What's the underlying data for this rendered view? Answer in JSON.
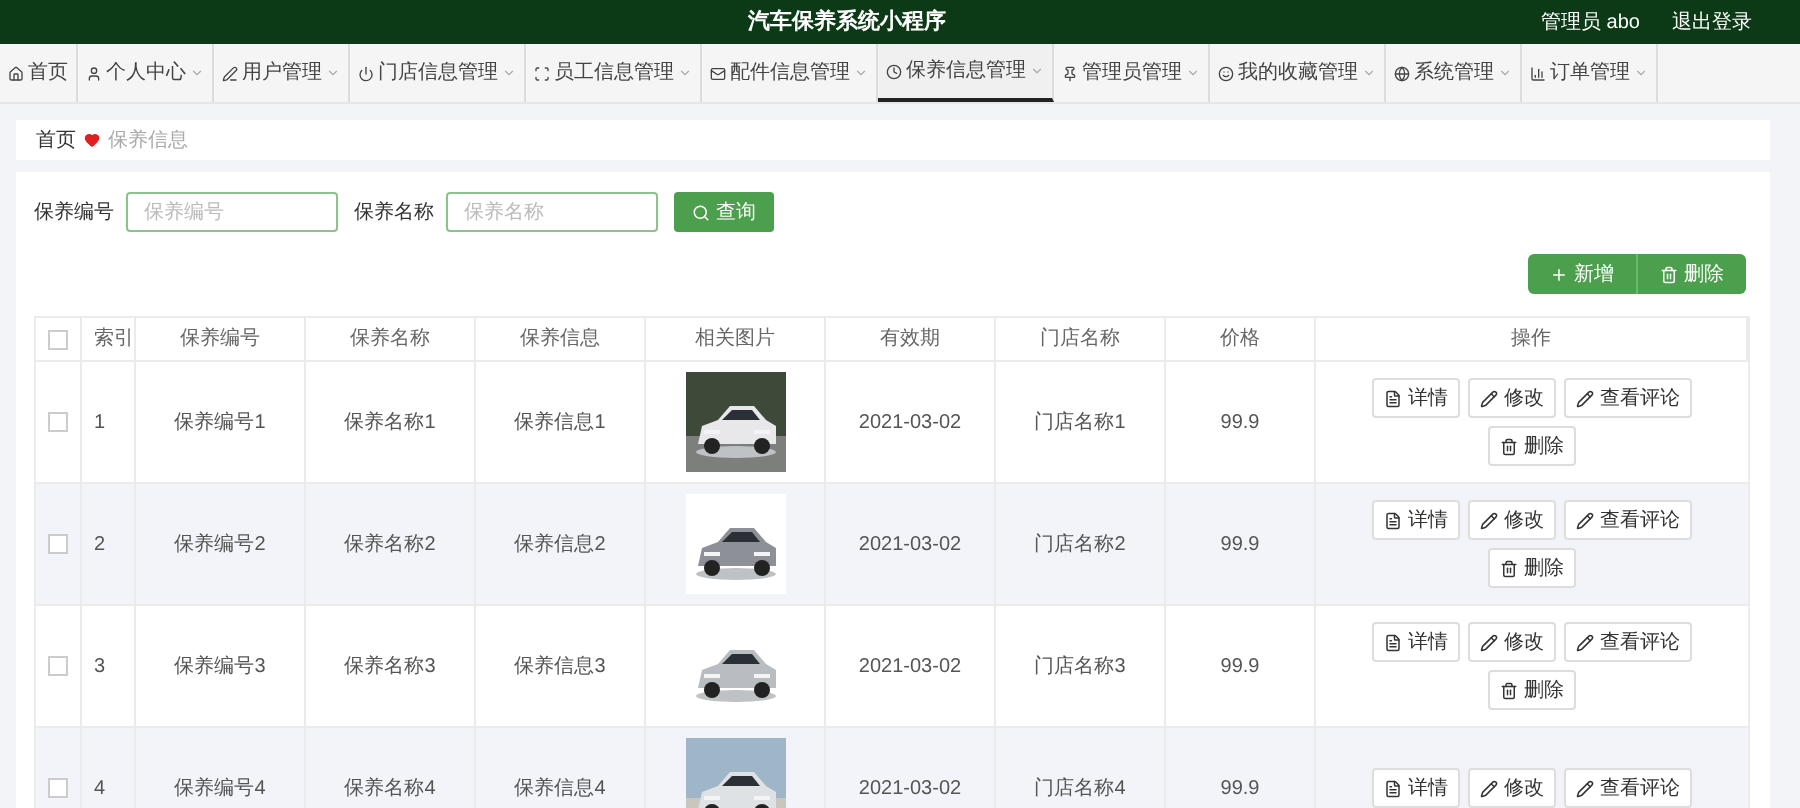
{
  "header": {
    "title": "汽车保养系统小程序",
    "user": "管理员 abo",
    "logout": "退出登录"
  },
  "nav": [
    {
      "label": "首页",
      "selected": false,
      "dropdown": false
    },
    {
      "label": "个人中心",
      "selected": false,
      "dropdown": true
    },
    {
      "label": "用户管理",
      "selected": false,
      "dropdown": true
    },
    {
      "label": "门店信息管理",
      "selected": false,
      "dropdown": true
    },
    {
      "label": "员工信息管理",
      "selected": false,
      "dropdown": true
    },
    {
      "label": "配件信息管理",
      "selected": false,
      "dropdown": true
    },
    {
      "label": "保养信息管理",
      "selected": true,
      "dropdown": true
    },
    {
      "label": "管理员管理",
      "selected": false,
      "dropdown": true
    },
    {
      "label": "我的收藏管理",
      "selected": false,
      "dropdown": true
    },
    {
      "label": "系统管理",
      "selected": false,
      "dropdown": true
    },
    {
      "label": "订单管理",
      "selected": false,
      "dropdown": true
    }
  ],
  "breadcrumb": {
    "home": "首页",
    "current": "保养信息"
  },
  "search": {
    "fields": [
      {
        "label": "保养编号",
        "placeholder": "保养编号"
      },
      {
        "label": "保养名称",
        "placeholder": "保养名称"
      }
    ],
    "button": "查询"
  },
  "toolbar": [
    {
      "kind": "add",
      "label": "新增"
    },
    {
      "kind": "delete",
      "label": "删除"
    }
  ],
  "table": {
    "select_all": {
      "checked": false
    },
    "columns": [
      "索引",
      "保养编号",
      "保养名称",
      "保养信息",
      "相关图片",
      "有效期",
      "门店名称",
      "价格",
      "操作"
    ],
    "rows": [
      {
        "checked": false,
        "index": "1",
        "code": "保养编号1",
        "name": "保养名称1",
        "info": "保养信息1",
        "image": {
          "kind": "picture"
        },
        "valid": "2021-03-02",
        "store": "门店名称1",
        "price": "99.9",
        "actions": [
          {
            "kind": "detail",
            "label": "详情"
          },
          {
            "kind": "edit",
            "label": "修改"
          },
          {
            "kind": "edit",
            "label": "查看评论"
          },
          {
            "kind": "delete",
            "label": "删除"
          }
        ]
      },
      {
        "checked": false,
        "index": "2",
        "code": "保养编号2",
        "name": "保养名称2",
        "info": "保养信息2",
        "image": {
          "kind": "picture"
        },
        "valid": "2021-03-02",
        "store": "门店名称2",
        "price": "99.9",
        "actions": [
          {
            "kind": "detail",
            "label": "详情"
          },
          {
            "kind": "edit",
            "label": "修改"
          },
          {
            "kind": "edit",
            "label": "查看评论"
          },
          {
            "kind": "delete",
            "label": "删除"
          }
        ]
      },
      {
        "checked": false,
        "index": "3",
        "code": "保养编号3",
        "name": "保养名称3",
        "info": "保养信息3",
        "image": {
          "kind": "picture"
        },
        "valid": "2021-03-02",
        "store": "门店名称3",
        "price": "99.9",
        "actions": [
          {
            "kind": "detail",
            "label": "详情"
          },
          {
            "kind": "edit",
            "label": "修改"
          },
          {
            "kind": "edit",
            "label": "查看评论"
          },
          {
            "kind": "delete",
            "label": "删除"
          }
        ]
      },
      {
        "checked": false,
        "index": "4",
        "code": "保养编号4",
        "name": "保养名称4",
        "info": "保养信息4",
        "image": {
          "kind": "picture"
        },
        "valid": "2021-03-02",
        "store": "门店名称4",
        "price": "99.9",
        "actions": [
          {
            "kind": "detail",
            "label": "详情"
          },
          {
            "kind": "edit",
            "label": "修改"
          },
          {
            "kind": "edit",
            "label": "查看评论"
          }
        ]
      }
    ]
  }
}
